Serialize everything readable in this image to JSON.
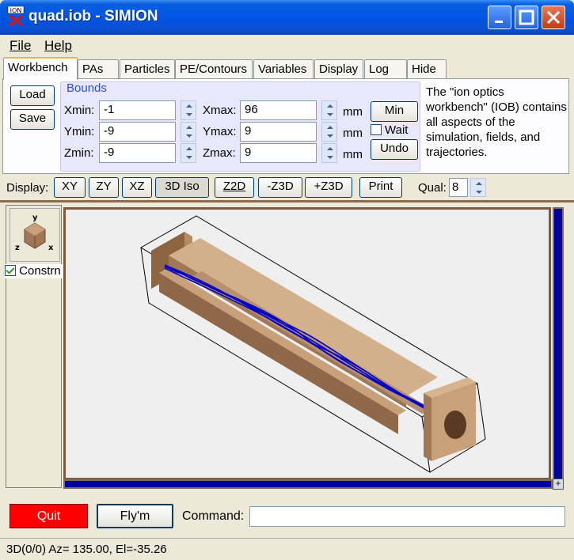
{
  "window": {
    "title": "quad.iob - SIMION",
    "app_icon_text": "ION"
  },
  "menu": {
    "file": "File",
    "help": "Help"
  },
  "tabs": [
    "Workbench",
    "PAs",
    "Particles",
    "PE/Contours",
    "Variables",
    "Display",
    "Log",
    "Hide"
  ],
  "workbench": {
    "load": "Load",
    "save": "Save",
    "bounds_title": "Bounds",
    "xmin_label": "Xmin:",
    "xmin": "-1",
    "ymin_label": "Ymin:",
    "ymin": "-9",
    "zmin_label": "Zmin:",
    "zmin": "-9",
    "xmax_label": "Xmax:",
    "xmax": "96",
    "ymax_label": "Ymax:",
    "ymax": "9",
    "zmax_label": "Zmax:",
    "zmax": "9",
    "unit": "mm",
    "min_button": "Min",
    "wait_label": "Wait",
    "undo_button": "Undo",
    "description": "The \"ion optics workbench\" (IOB) contains all aspects of the simulation, fields, and trajectories."
  },
  "display_bar": {
    "label": "Display:",
    "buttons": [
      "XY",
      "ZY",
      "XZ",
      "3D Iso",
      "Z2D",
      "-Z3D",
      "+Z3D",
      "Print"
    ],
    "qual_label": "Qual:",
    "qual_value": "8"
  },
  "side": {
    "constrain": "Constrn",
    "axes": {
      "y": "y",
      "z": "z",
      "x": "x"
    }
  },
  "bottom": {
    "quit": "Quit",
    "flym": "Fly'm",
    "command_label": "Command:",
    "command_value": ""
  },
  "status": "3D(0/0) Az= 135.00, El=-35.26",
  "colors": {
    "electrode": "#c8a07a",
    "trajectory": "#0000c8",
    "quit_bg": "#ff0000",
    "title_bar": "#0054e3"
  }
}
